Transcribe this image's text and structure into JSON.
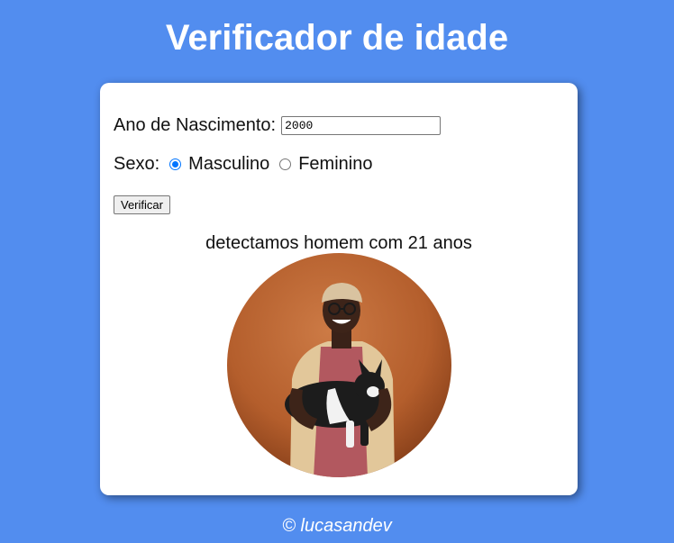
{
  "header": {
    "title": "Verificador de idade"
  },
  "form": {
    "year_label": "Ano de Nascimento:",
    "year_value": "2000",
    "sex_label": "Sexo:",
    "options": [
      {
        "label": "Masculino",
        "checked": true
      },
      {
        "label": "Feminino",
        "checked": false
      }
    ],
    "submit_label": "Verificar"
  },
  "result": {
    "text": "detectamos homem com 21 anos",
    "image_icon": "photo-man-holding-dog"
  },
  "footer": {
    "text": "© lucasandev"
  },
  "colors": {
    "background": "#528def",
    "card": "#ffffff",
    "radio_accent": "#0075ff"
  }
}
